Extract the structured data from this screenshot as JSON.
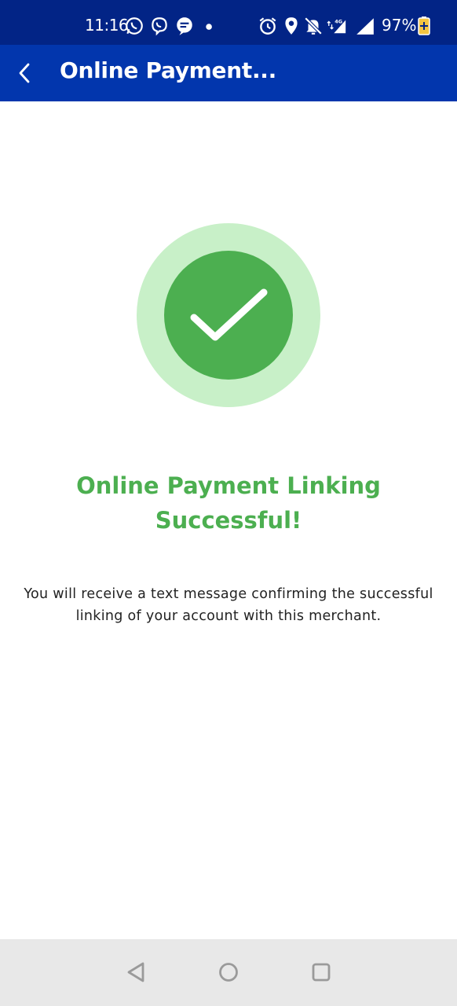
{
  "status_bar": {
    "time": "11:16",
    "battery_percent": "97%",
    "icons": [
      "whatsapp-icon",
      "viber-icon",
      "message-icon",
      "dot-icon",
      "alarm-icon",
      "location-icon",
      "bell-muted-icon",
      "signal-4g-icon",
      "signal-icon",
      "battery-icon"
    ]
  },
  "app_bar": {
    "title": "Online Payment..."
  },
  "main": {
    "success_title": "Online Payment Linking Successful!",
    "success_message": "You will receive a text message confirming the successful linking of your account with this merchant."
  },
  "colors": {
    "status_bar_bg": "#022486",
    "app_bar_bg": "#0236ad",
    "success_green": "#4caf50",
    "success_halo": "#c8f0c8"
  }
}
